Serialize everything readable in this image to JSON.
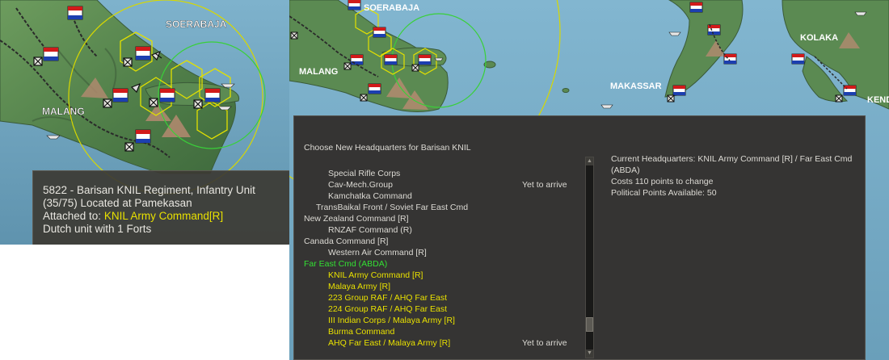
{
  "map_left": {
    "labels": [
      "SOERABAJA",
      "MALANG"
    ]
  },
  "map_right": {
    "labels": [
      "SOERABAJA",
      "MALANG",
      "MAKASSAR",
      "KOLAKA",
      "KEND"
    ]
  },
  "unit_tooltip": {
    "line1": "5822 - Barisan KNIL Regiment, Infantry Unit",
    "line2": "(35/75) Located at Pamekasan",
    "attached_prefix": "Attached to: ",
    "attached_hq": "KNIL Army Command[R]",
    "line4": "Dutch unit with 1 Forts"
  },
  "hq_dialog": {
    "title": "Choose New Headquarters for Barisan KNIL",
    "entries": [
      {
        "label": "Special Rifle Corps",
        "status": "",
        "color": "white"
      },
      {
        "label": "Cav-Mech.Group",
        "status": "Yet to arrive",
        "color": "white"
      },
      {
        "label": "Kamchatka Command",
        "status": "",
        "color": "white"
      },
      {
        "label": "TransBaikal Front  / Soviet Far East Cmd",
        "status": "",
        "color": "white"
      },
      {
        "label": "New Zealand Command [R]",
        "status": "",
        "color": "white"
      },
      {
        "label": "RNZAF Command  (R)",
        "status": "",
        "color": "white"
      },
      {
        "label": "Canada Command [R]",
        "status": "",
        "color": "white"
      },
      {
        "label": "Western Air Command [R]",
        "status": "",
        "color": "white"
      },
      {
        "label": "Far East Cmd (ABDA)",
        "status": "",
        "color": "green"
      },
      {
        "label": "KNIL Army Command [R]",
        "status": "",
        "color": "yellow"
      },
      {
        "label": "Malaya Army [R]",
        "status": "",
        "color": "yellow"
      },
      {
        "label": "223 Group RAF  / AHQ Far East",
        "status": "",
        "color": "yellow"
      },
      {
        "label": "224 Group RAF  / AHQ Far East",
        "status": "",
        "color": "yellow"
      },
      {
        "label": "III Indian Corps / Malaya Army [R]",
        "status": "",
        "color": "yellow"
      },
      {
        "label": "Burma Command",
        "status": "",
        "color": "yellow"
      },
      {
        "label": "AHQ Far East  / Malaya Army [R]",
        "status": "Yet to arrive",
        "color": "yellow"
      }
    ],
    "current_hq": "Current Headquarters: KNIL Army Command [R] / Far East Cmd (ABDA)",
    "cost": "Costs 110 points to change",
    "political_points": "Political Points Available:  50"
  },
  "colors": {
    "sea": "#6fa3bf",
    "land": "#5d8c55",
    "hex_yellow": "#e2e000",
    "range_green": "#39d039",
    "range_yellow": "#d8d800",
    "dialog_bg": "#353433",
    "hq_green": "#33e033",
    "hq_yellow": "#e8e000"
  },
  "icons": [
    "dutch-flag-icon",
    "ship-icon",
    "airbase-icon",
    "fort-icon",
    "scroll-up-icon",
    "scroll-down-icon"
  ]
}
